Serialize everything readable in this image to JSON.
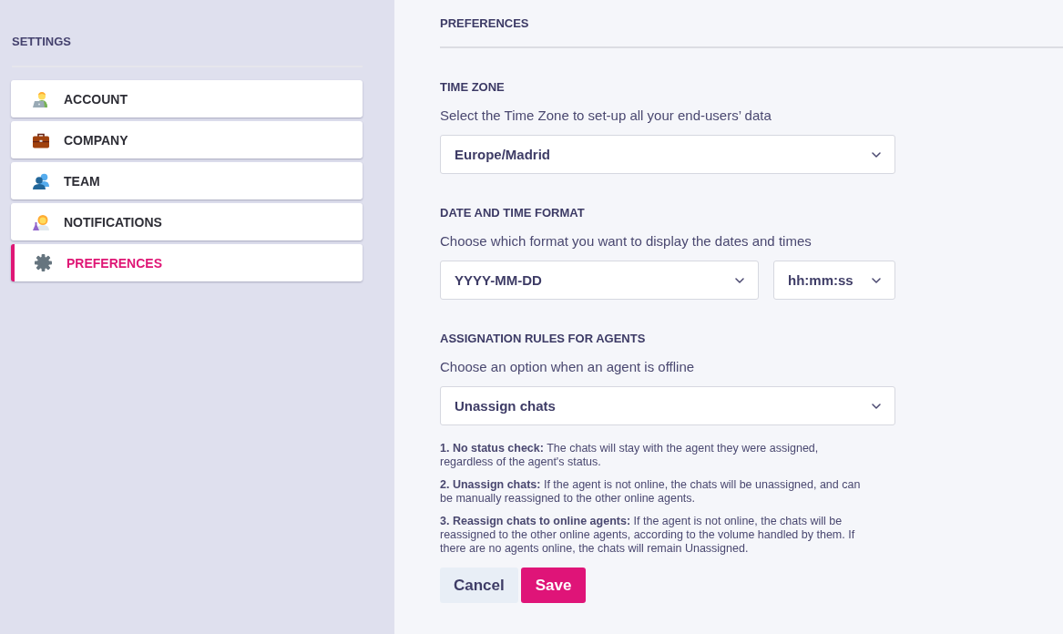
{
  "sidebar": {
    "title": "SETTINGS",
    "items": [
      {
        "label": "ACCOUNT",
        "selected": false
      },
      {
        "label": "COMPANY",
        "selected": false
      },
      {
        "label": "TEAM",
        "selected": false
      },
      {
        "label": "NOTIFICATIONS",
        "selected": false
      },
      {
        "label": "PREFERENCES",
        "selected": true
      }
    ]
  },
  "main": {
    "title": "PREFERENCES",
    "sections": [
      {
        "heading": "TIME ZONE",
        "description": "Select the Time Zone to set-up all your end-users’ data",
        "dropdowns": [
          {
            "value": "Europe/Madrid"
          }
        ]
      },
      {
        "heading": "DATE AND TIME FORMAT",
        "description": "Choose which format you want to display the dates and times",
        "dropdowns": [
          {
            "value": "YYYY-MM-DD"
          },
          {
            "value": "hh:mm:ss"
          }
        ]
      },
      {
        "heading": "ASSIGNATION RULES FOR AGENTS",
        "description": "Choose an option when an agent is offline",
        "dropdowns": [
          {
            "value": "Unassign chats"
          }
        ],
        "notes": [
          "**1. No status check:** The chats will stay with the agent they were assigned, regardless of the agent's status.",
          "**2. Unassign chats:** If the agent is not online, the chats will be unassigned, and can be manually reassigned to the other online agents.",
          "**3. Reassign chats to online agents:** If the agent is not online, the chats will be reassigned to the other online agents, according to the volume handled by them. If there are no agents online, the chats will remain Unassigned."
        ]
      }
    ],
    "buttons": [
      {
        "label": "Cancel",
        "kind": "secondary"
      },
      {
        "label": "Save",
        "kind": "primary"
      }
    ]
  }
}
